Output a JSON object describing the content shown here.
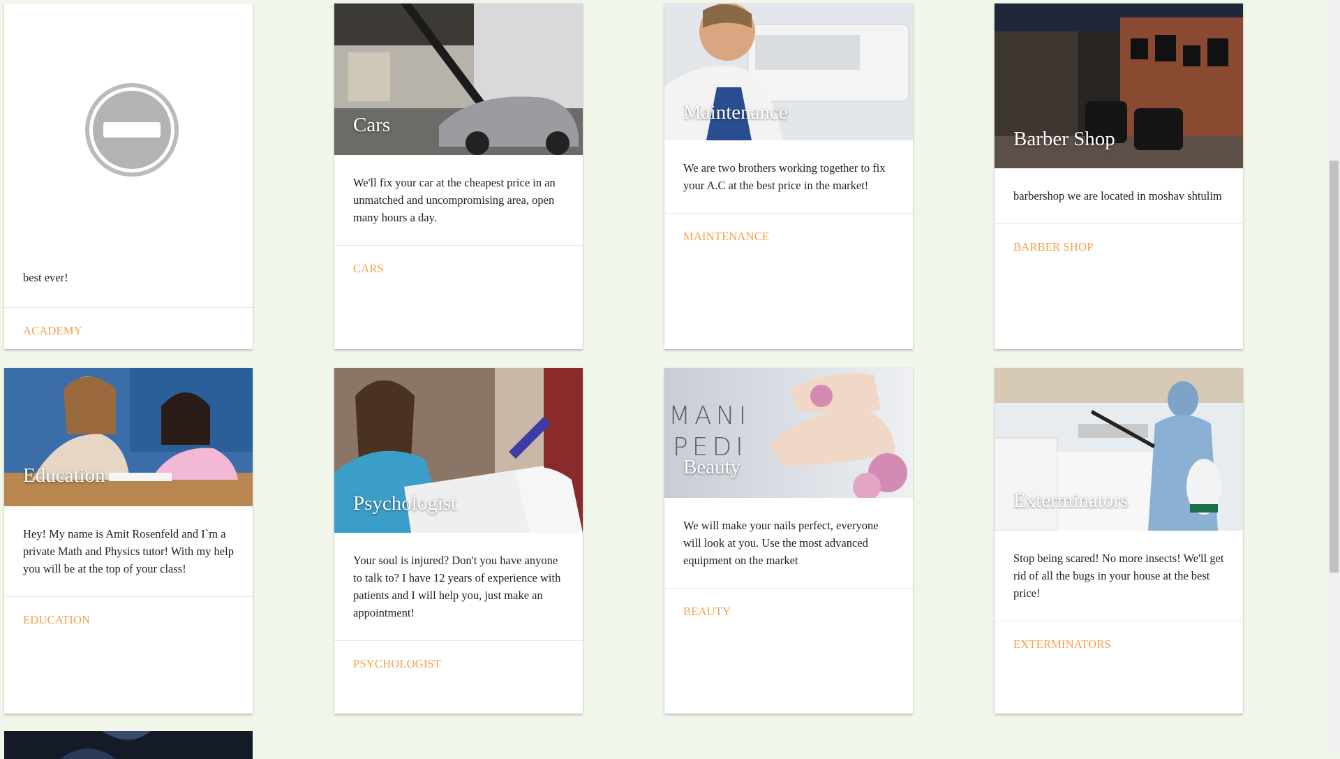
{
  "cards": [
    {
      "id": "academy",
      "title": "",
      "text": "best ever!",
      "link": "ACADEMY"
    },
    {
      "id": "cars",
      "title": "Cars",
      "text": "We'll fix your car at the cheapest price in an unmatched and uncompromising area, open many hours a day.",
      "link": "CARS"
    },
    {
      "id": "maintenance",
      "title": "Maintenance",
      "text": "We are two brothers working together to fix your A.C at the best price in the market!",
      "link": "MAINTENANCE"
    },
    {
      "id": "barber",
      "title": "Barber Shop",
      "text": "barbershop we are located in moshav shtulim",
      "link": "BARBER SHOP"
    },
    {
      "id": "education",
      "title": "Education",
      "text": "Hey! My name is Amit Rosenfeld and I`m a private Math and Physics tutor! With my help you will be at the top of your class!",
      "link": "EDUCATION"
    },
    {
      "id": "psychologist",
      "title": "Psychologist",
      "text": "Your soul is injured? Don't you have anyone to talk to? I have 12 years of experience with patients and I will help you, just make an appointment!",
      "link": "PSYCHOLOGIST"
    },
    {
      "id": "beauty",
      "title": "Beauty",
      "text": "We will make your nails perfect, everyone will look at you. Use the most advanced equipment on the market",
      "link": "BEAUTY"
    },
    {
      "id": "exterminators",
      "title": "Exterminators",
      "text": "Stop being scared! No more insects! We'll get rid of all the bugs in your house at the best price!",
      "link": "EXTERMINATORS"
    }
  ],
  "beauty_image_text": {
    "line1": "MANI",
    "line2": "PEDI"
  },
  "colors": {
    "background": "#f1f6ea",
    "link": "#f3a04b"
  },
  "icons": {
    "academy_placeholder": "no-entry-icon"
  }
}
